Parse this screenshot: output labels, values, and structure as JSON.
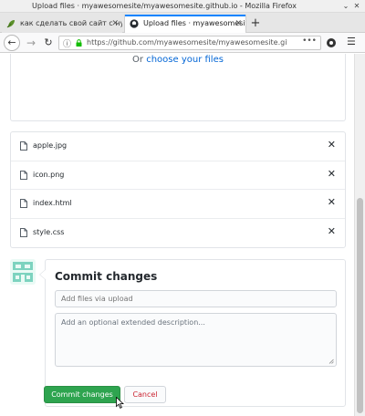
{
  "window": {
    "title": "Upload files · myawesomesite/myawesomesite.github.io - Mozilla Firefox"
  },
  "tabs": [
    {
      "label": "как сделать свой сайт с нул",
      "icon": "leaf-favicon-icon"
    },
    {
      "label": "Upload files · myawesomesite",
      "icon": "github-favicon-icon",
      "active": true
    }
  ],
  "navbar": {
    "url": "https://github.com/myawesomesite/myawesomesite.github.io/upl",
    "more_label": "•••"
  },
  "upload": {
    "choose_prefix": "Or",
    "choose_link": "choose your files"
  },
  "files": [
    {
      "name": "apple.jpg"
    },
    {
      "name": "icon.png"
    },
    {
      "name": "index.html"
    },
    {
      "name": "style.css"
    }
  ],
  "commit": {
    "title": "Commit changes",
    "summary_placeholder": "Add files via upload",
    "description_placeholder": "Add an optional extended description...",
    "commit_button": "Commit changes",
    "cancel_button": "Cancel"
  },
  "colors": {
    "accent": "#2ea44f",
    "link": "#0366d6",
    "danger": "#cb2431",
    "tab_active": "#0a84ff"
  }
}
